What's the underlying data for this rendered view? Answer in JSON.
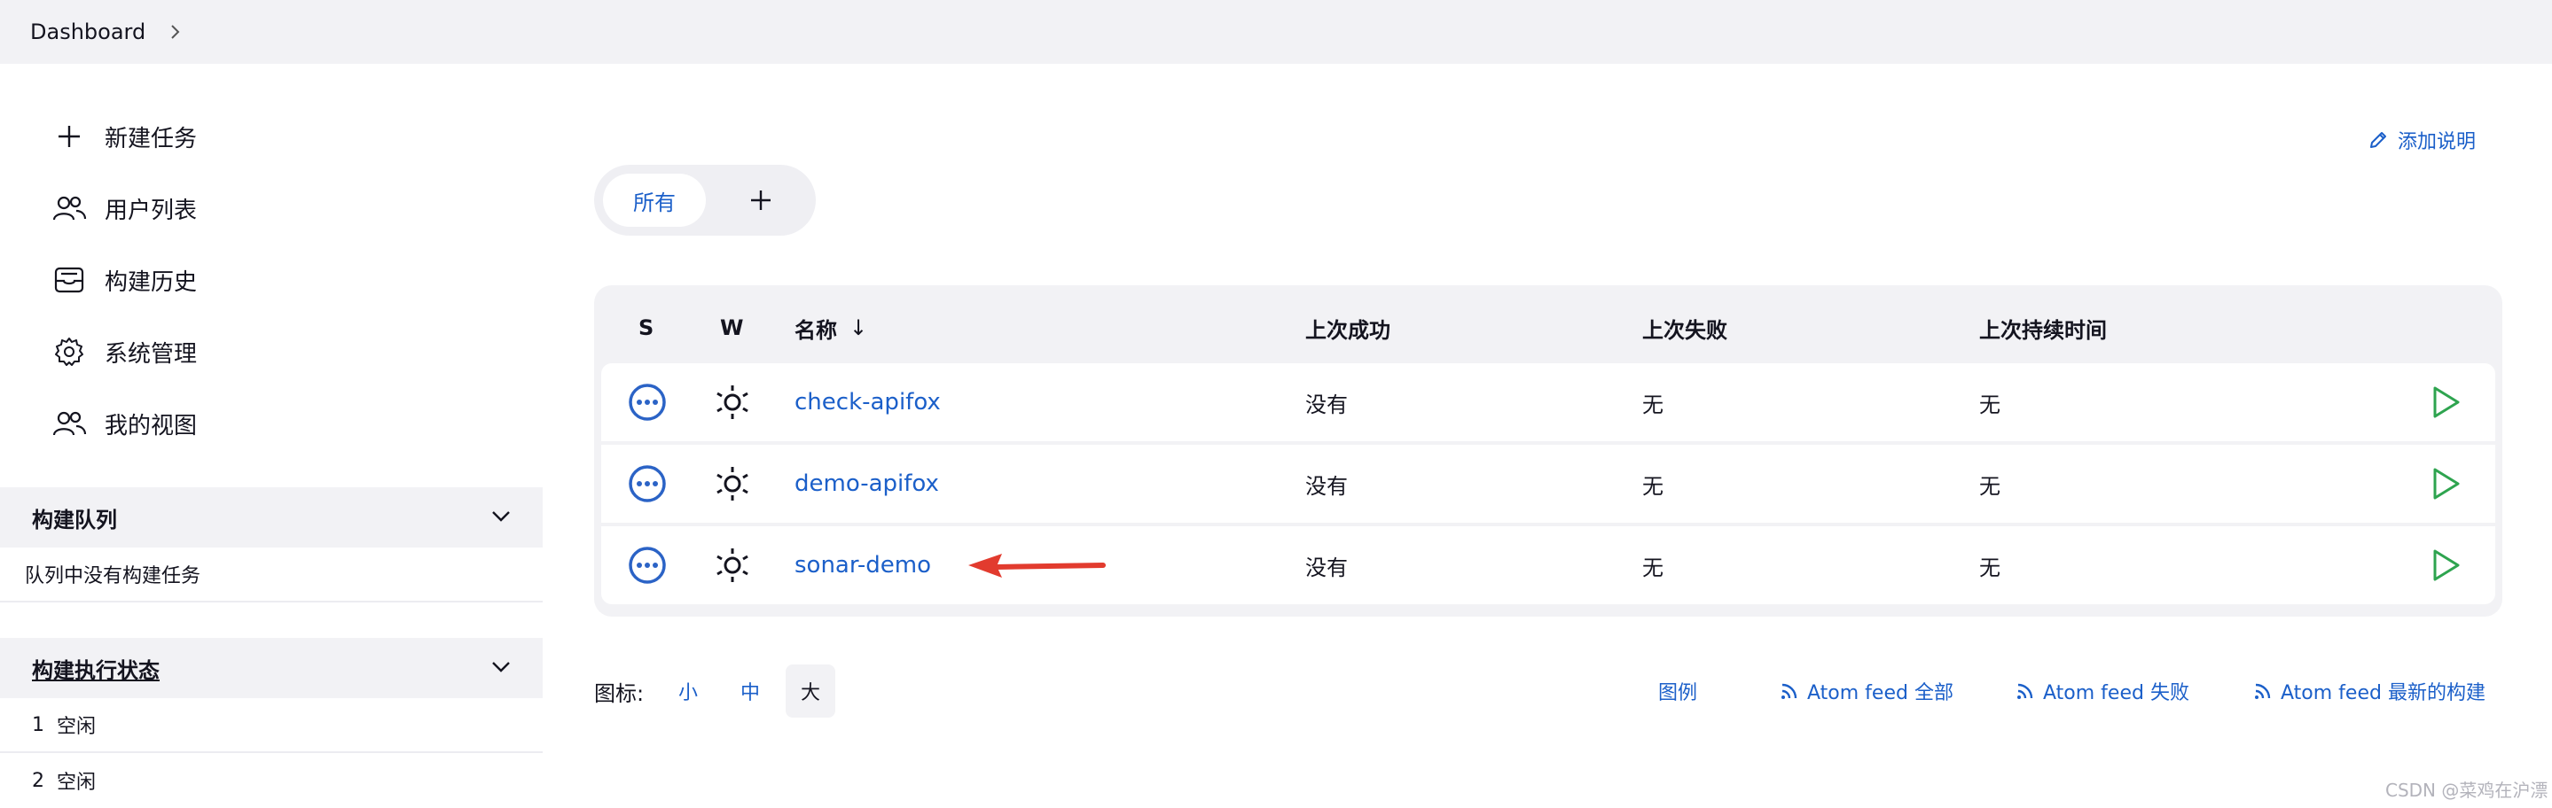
{
  "breadcrumb": {
    "items": [
      "Dashboard"
    ]
  },
  "sidebar": {
    "tasks": [
      {
        "label": "新建任务",
        "icon": "plus-icon"
      },
      {
        "label": "用户列表",
        "icon": "users-icon"
      },
      {
        "label": "构建历史",
        "icon": "inbox-icon"
      },
      {
        "label": "系统管理",
        "icon": "gear-icon"
      },
      {
        "label": "我的视图",
        "icon": "users-icon"
      }
    ],
    "queue": {
      "title": "构建队列",
      "empty_text": "队列中没有构建任务"
    },
    "executors": {
      "title": "构建执行状态",
      "rows": [
        {
          "index": "1",
          "status": "空闲"
        },
        {
          "index": "2",
          "status": "空闲"
        }
      ]
    }
  },
  "main": {
    "add_description": "添加说明",
    "tabs": {
      "all_label": "所有"
    },
    "table": {
      "headers": {
        "s": "S",
        "w": "W",
        "name": "名称",
        "last_success": "上次成功",
        "last_failure": "上次失败",
        "last_duration": "上次持续时间"
      },
      "sort_indicator": "↓",
      "rows": [
        {
          "name": "check-apifox",
          "last_success": "没有",
          "last_failure": "无",
          "last_duration": "无"
        },
        {
          "name": "demo-apifox",
          "last_success": "没有",
          "last_failure": "无",
          "last_duration": "无"
        },
        {
          "name": "sonar-demo",
          "last_success": "没有",
          "last_failure": "无",
          "last_duration": "无"
        }
      ]
    },
    "icon_size": {
      "label": "图标:",
      "options": [
        "小",
        "中",
        "大"
      ],
      "selected": "大"
    },
    "footer_links": {
      "legend": "图例",
      "atom_all": "Atom feed 全部",
      "atom_failed": "Atom feed 失败",
      "atom_latest": "Atom feed 最新的构建"
    }
  },
  "watermark": "CSDN @菜鸡在沪漂",
  "colors": {
    "link": "#1b5fc9",
    "status_icon": "#2b63c6",
    "run_icon": "#2ea44f",
    "annotation_arrow": "#e23b2e"
  }
}
